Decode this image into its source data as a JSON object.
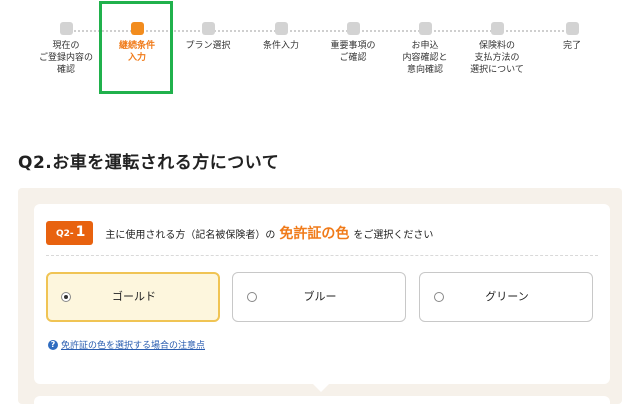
{
  "stepper": {
    "steps": [
      {
        "label": "現在の\nご登録内容の\n確認",
        "state": "inactive"
      },
      {
        "label": "継続条件\n入力",
        "state": "current"
      },
      {
        "label": "プラン選択",
        "state": "inactive"
      },
      {
        "label": "条件入力",
        "state": "inactive"
      },
      {
        "label": "重要事項の\nご確認",
        "state": "inactive"
      },
      {
        "label": "お申込\n内容確認と\n意向確認",
        "state": "inactive"
      },
      {
        "label": "保険料の\n支払方法の\n選択について",
        "state": "inactive"
      },
      {
        "label": "完了",
        "state": "inactive"
      }
    ],
    "highlight_color": "#20b14c",
    "current_color": "#f28c1e"
  },
  "page": {
    "title": "Q2.お車を運転される方について"
  },
  "question": {
    "badge_prefix": "Q2-",
    "badge_number": "1",
    "text_before": "主に使用される方（記名被保険者）の",
    "text_emphasis": "免許証の色",
    "text_after": "をご選択ください",
    "options": [
      {
        "label": "ゴールド",
        "selected": true
      },
      {
        "label": "ブルー",
        "selected": false
      },
      {
        "label": "グリーン",
        "selected": false
      }
    ],
    "help_icon": "question-circle-icon",
    "note_link": "免許証の色を選択する場合の注意点",
    "accent_color": "#e8620f"
  }
}
